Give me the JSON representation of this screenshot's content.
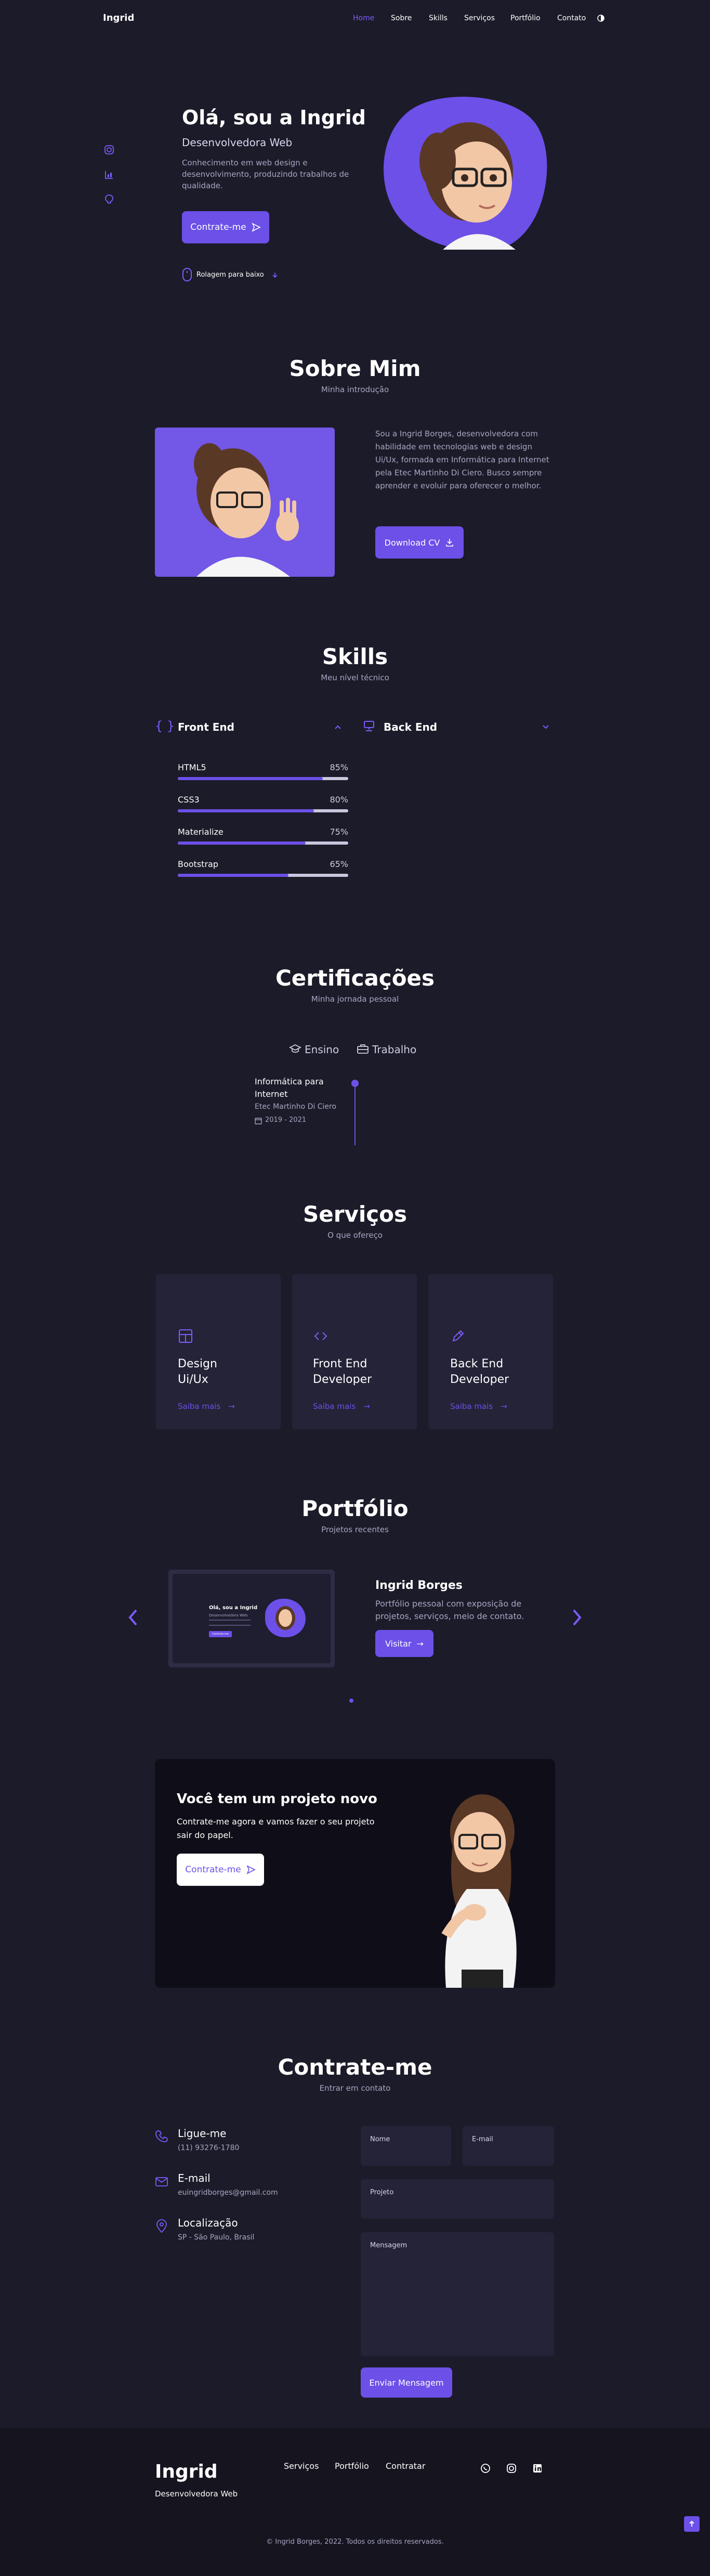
{
  "nav": {
    "logo": "Ingrid",
    "links": [
      "Home",
      "Sobre",
      "Skills",
      "Serviços",
      "Portfólio",
      "Contato"
    ]
  },
  "hero": {
    "title": "Olá, sou a Ingrid",
    "role": "Desenvolvedora Web",
    "description": "Conhecimento em web design e desenvolvimento, produzindo trabalhos de qualidade.",
    "cta": "Contrate-me",
    "scroll": "Rolagem para baixo"
  },
  "about": {
    "title": "Sobre Mim",
    "subtitle": "Minha introdução",
    "text": "Sou a Ingrid Borges, desenvolvedora com habilidade em tecnologias web e design Ui/Ux, formada em Informática para Internet pela Etec Martinho Di Ciero. Busco sempre aprender e evoluir para oferecer o melhor.",
    "download": "Download CV"
  },
  "skills": {
    "title": "Skills",
    "subtitle": "Meu nível técnico",
    "front_title": "Front End",
    "back_title": "Back End",
    "items": [
      {
        "name": "HTML5",
        "pct": "85%",
        "value": 85
      },
      {
        "name": "CSS3",
        "pct": "80%",
        "value": 80
      },
      {
        "name": "Materialize",
        "pct": "75%",
        "value": 75
      },
      {
        "name": "Bootstrap",
        "pct": "65%",
        "value": 65
      }
    ]
  },
  "certs": {
    "title": "Certificações",
    "subtitle": "Minha jornada pessoal",
    "tab_education": "Ensino",
    "tab_work": "Trabalho",
    "entry_title": "Informática para Internet",
    "entry_school": "Etec Martinho Di Ciero",
    "entry_date": "2019 - 2021"
  },
  "services": {
    "title": "Serviços",
    "subtitle": "O que ofereço",
    "items": [
      {
        "line1": "Design",
        "line2": "Ui/Ux",
        "more": "Saiba mais"
      },
      {
        "line1": "Front End",
        "line2": "Developer",
        "more": "Saiba mais"
      },
      {
        "line1": "Back End",
        "line2": "Developer",
        "more": "Saiba mais"
      }
    ]
  },
  "portfolio": {
    "title": "Portfólio",
    "subtitle": "Projetos recentes",
    "project_title": "Ingrid Borges",
    "project_desc": "Portfólio pessoal com exposição de projetos, serviços, meio de contato.",
    "visit": "Visitar",
    "mini_title": "Olá, sou a Ingrid",
    "mini_role": "Desenvolvedora Web",
    "mini_btn": "Contrate-me"
  },
  "banner": {
    "title": "Você tem um projeto novo",
    "text": "Contrate-me agora e vamos fazer o seu projeto sair do papel.",
    "cta": "Contrate-me"
  },
  "contact": {
    "title": "Contrate-me",
    "subtitle": "Entrar em contato",
    "phone_label": "Ligue-me",
    "phone": "(11) 93276-1780",
    "email_label": "E-mail",
    "email": "euingridborges@gmail.com",
    "loc_label": "Localização",
    "loc": "SP - São Paulo, Brasil",
    "f_name": "Nome",
    "f_email": "E-mail",
    "f_project": "Projeto",
    "f_message": "Mensagem",
    "send": "Enviar Mensagem"
  },
  "footer": {
    "logo": "Ingrid",
    "role": "Desenvolvedora Web",
    "links": [
      "Serviços",
      "Portfólio",
      "Contratar"
    ],
    "copyright": "© Ingrid Borges, 2022. Todos os direitos reservados."
  },
  "colors": {
    "accent": "#6c50e8",
    "bg": "#1c1b29",
    "card": "#252338",
    "footer": "#15141f"
  }
}
